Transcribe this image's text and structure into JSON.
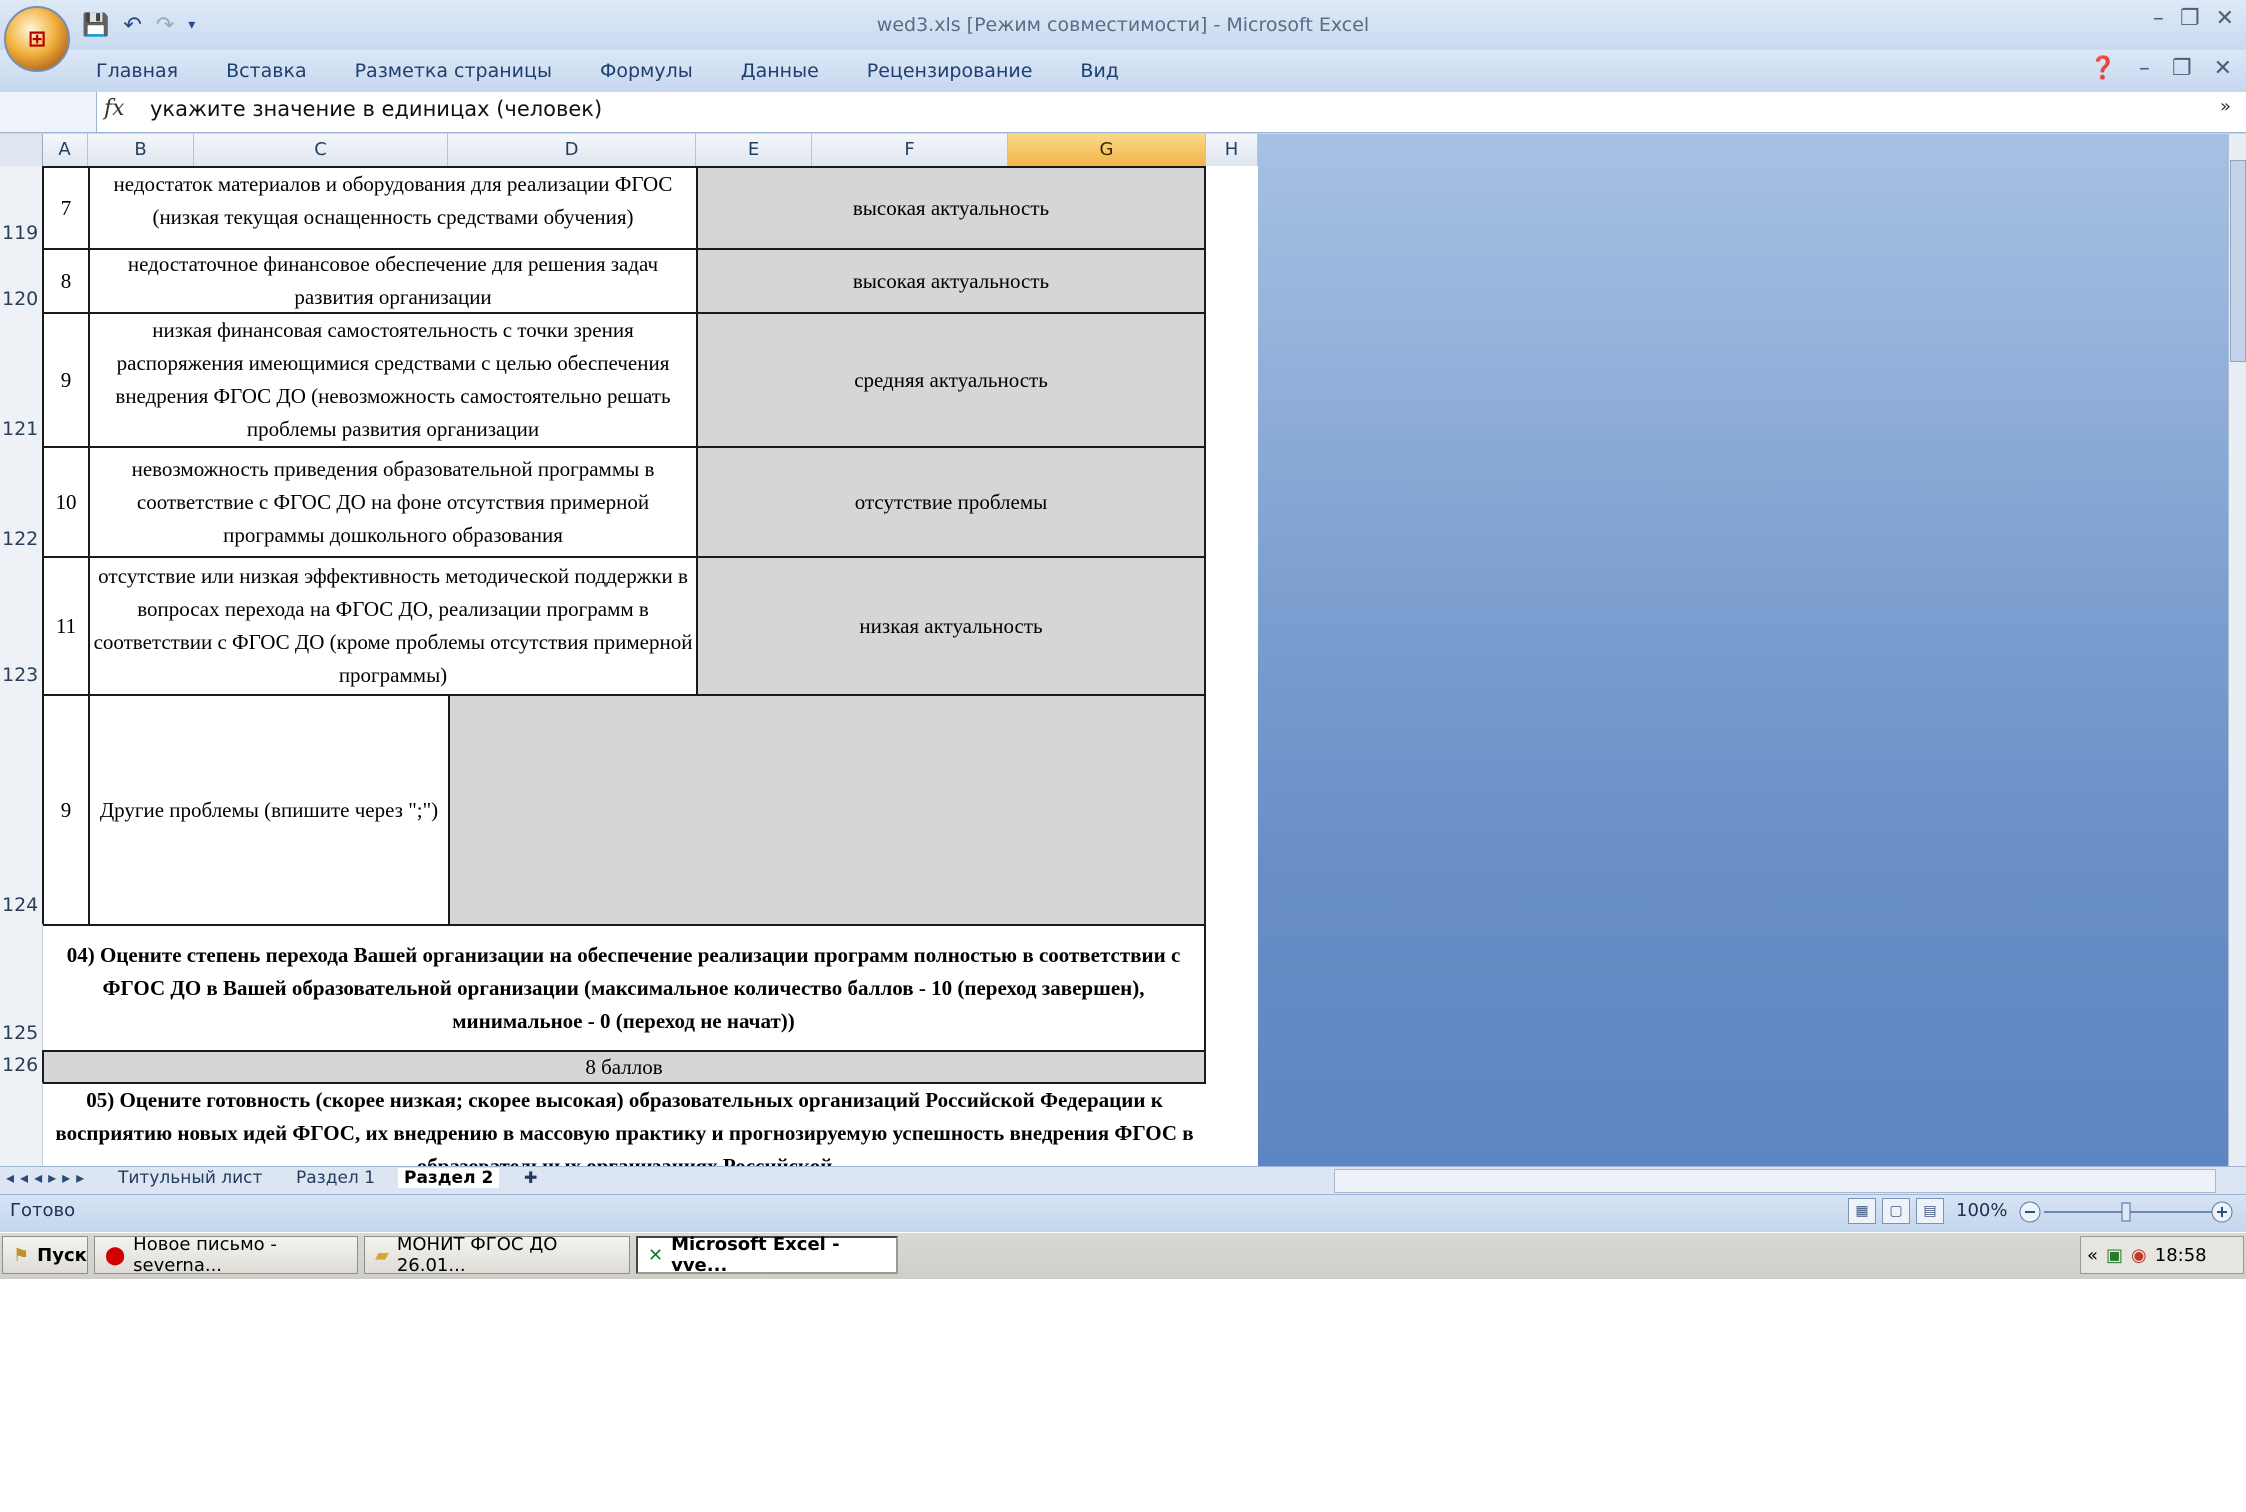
{
  "window": {
    "title": "wed3.xls [Режим совместимости] - Microsoft Excel"
  },
  "ribbon": {
    "tabs": [
      "Главная",
      "Вставка",
      "Разметка страницы",
      "Формулы",
      "Данные",
      "Рецензирование",
      "Вид"
    ]
  },
  "formula_bar": {
    "fx": "fx",
    "value": "укажите значение в единицах (человек)"
  },
  "columns": [
    "A",
    "B",
    "C",
    "D",
    "E",
    "F",
    "G",
    "H"
  ],
  "selected_column": "G",
  "rows": [
    {
      "num": "119",
      "idx": "7",
      "text": "недостаток материалов и оборудования для реализации ФГОС (низкая текущая оснащенность средствами обучения)",
      "answer": "высокая актуальность"
    },
    {
      "num": "120",
      "idx": "8",
      "text": "недостаточное финансовое обеспечение для решения задач развития организации",
      "answer": "высокая актуальность"
    },
    {
      "num": "121",
      "idx": "9",
      "text": "низкая финансовая самостоятельность с точки зрения распоряжения имеющимися средствами с целью обеспечения внедрения ФГОС ДО (невозможность самостоятельно решать проблемы развития организации",
      "answer": "средняя актуальность"
    },
    {
      "num": "122",
      "idx": "10",
      "text": "невозможность приведения образовательной программы в соответствие с ФГОС ДО на фоне отсутствия примерной программы дошкольного образования",
      "answer": "отсутствие проблемы"
    },
    {
      "num": "123",
      "idx": "11",
      "text": "отсутствие или низкая эффективность методической поддержки в вопросах перехода на ФГОС ДО, реализации программ в соответствии с ФГОС ДО (кроме проблемы отсутствия примерной программы)",
      "answer": "низкая актуальность"
    }
  ],
  "other_row": {
    "num": "124",
    "idx": "9",
    "text": "Другие проблемы (впишите через \";\")"
  },
  "question4": {
    "num": "125",
    "text": "04) Оцените степень перехода Вашей организации на обеспечение реализации программ полностью в соответствии с ФГОС ДО в Вашей образовательной организации (максимальное количество баллов - 10 (переход завершен), минимальное - 0 (переход не начат))"
  },
  "answer4": {
    "num": "126",
    "text": "8 баллов"
  },
  "question5": {
    "text": "05) Оцените  готовность (скорее низкая; скорее высокая) образовательных организаций Российской Федерации к восприятию новых идей ФГОС, их внедрению в массовую практику и прогнозируемую успешность  внедрения ФГОС в  образовательных организациях  Российской"
  },
  "sheet_tabs": [
    "Титульный лист",
    "Раздел 1",
    "Раздел 2"
  ],
  "active_sheet": "Раздел 2",
  "status": {
    "text": "Готово",
    "zoom": "100%"
  },
  "taskbar": {
    "start": "Пуск",
    "items": [
      "Новое письмо - severna...",
      "МОНИТ ФГОС ДО 26.01...",
      "Microsoft Excel - vve..."
    ],
    "clock": "18:58"
  },
  "colors": {
    "accent": "#f3b54a",
    "gray_cell": "#d6d6d6",
    "ribbon": "#c6d8ef"
  }
}
